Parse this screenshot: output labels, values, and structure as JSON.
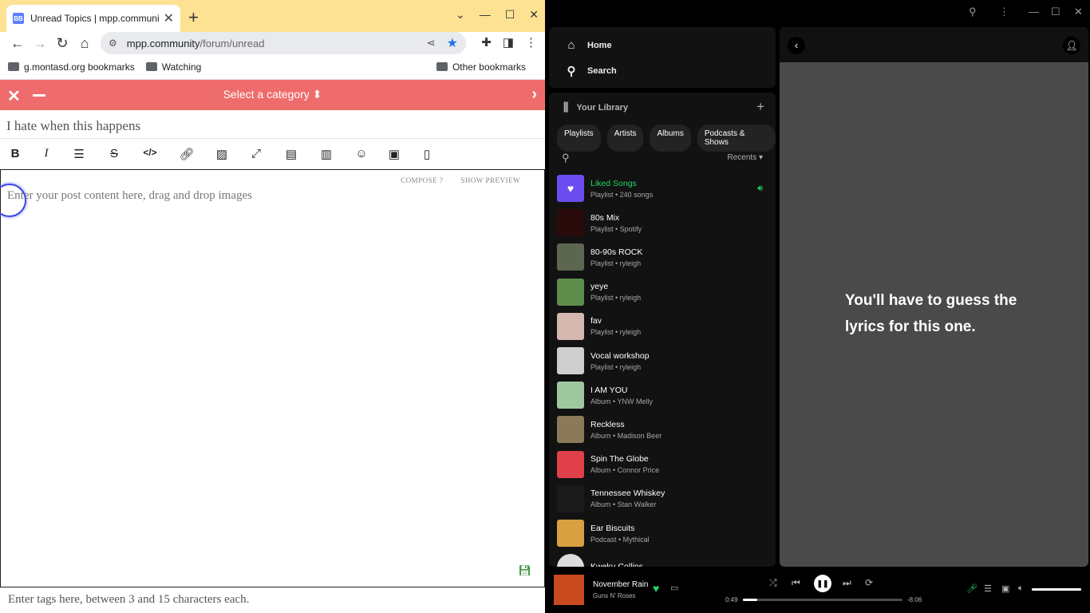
{
  "browser": {
    "tab_title": "Unread Topics | mpp.community",
    "url_host": "mpp.community",
    "url_path": "/forum/unread",
    "bookmarks": [
      "g.montasd.org bookmarks",
      "Watching"
    ],
    "other_bookmarks": "Other bookmarks"
  },
  "composer": {
    "category_label": "Select a category",
    "title_value": "I hate when this happens",
    "compose_tab": "COMPOSE",
    "preview_tab": "SHOW PREVIEW",
    "body_placeholder": "Enter your post content here, drag and drop images",
    "tags_placeholder": "Enter tags here, between 3 and 15 characters each."
  },
  "spotify": {
    "nav": {
      "home": "Home",
      "search": "Search"
    },
    "library_title": "Your Library",
    "filters": [
      "Playlists",
      "Artists",
      "Albums",
      "Podcasts & Shows"
    ],
    "sort_label": "Recents",
    "items": [
      {
        "name": "Liked Songs",
        "sub": "Playlist • 240 songs",
        "color": "#6b4cf0",
        "active": true
      },
      {
        "name": "80s Mix",
        "sub": "Playlist • Spotify",
        "color": "#2a0a0a"
      },
      {
        "name": "80-90s ROCK",
        "sub": "Playlist • ryleigh",
        "color": "#5c6650"
      },
      {
        "name": "yeye",
        "sub": "Playlist • ryleigh",
        "color": "#5e8c4a"
      },
      {
        "name": "fav",
        "sub": "Playlist • ryleigh",
        "color": "#d4b8b0"
      },
      {
        "name": "Vocal workshop",
        "sub": "Playlist • ryleigh",
        "color": "#cfcfcf"
      },
      {
        "name": "I AM YOU",
        "sub": "Album • YNW Melly",
        "color": "#9fc7a0"
      },
      {
        "name": "Reckless",
        "sub": "Album • Madison Beer",
        "color": "#8a7a5a"
      },
      {
        "name": "Spin The Globe",
        "sub": "Album • Connor Price",
        "color": "#e0404a"
      },
      {
        "name": "Tennessee Whiskey",
        "sub": "Album • Stan Walker",
        "color": "#1a1a1a"
      },
      {
        "name": "Ear Biscuits",
        "sub": "Podcast • Mythical",
        "color": "#d8a040"
      },
      {
        "name": "Kweku Collins",
        "sub": "",
        "color": "#dddddd"
      }
    ],
    "lyrics_message": "You'll have to guess the lyrics for this one.",
    "now_playing": {
      "title": "November Rain",
      "artist": "Guns N' Roses",
      "elapsed": "0:49",
      "remaining": "-8:06",
      "progress": 0.09,
      "volume": 1.0
    }
  }
}
